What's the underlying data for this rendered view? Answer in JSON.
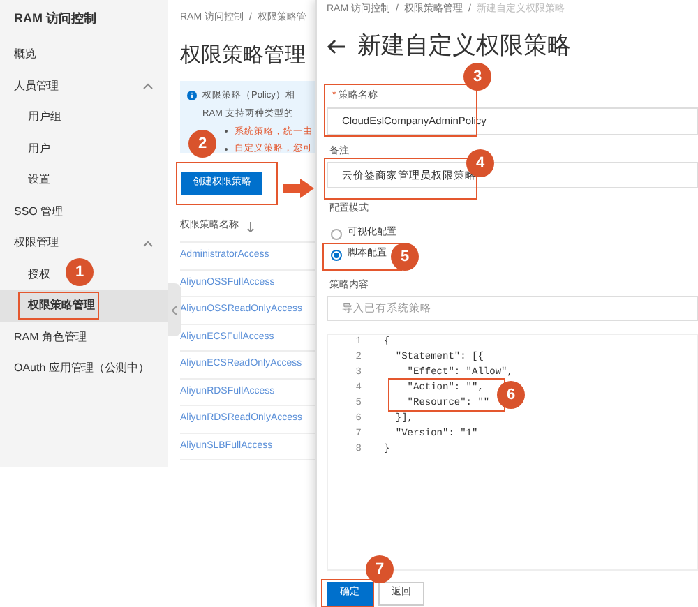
{
  "sidebar": {
    "title": "RAM 访问控制",
    "items": [
      {
        "label": "概览",
        "selected": false
      },
      {
        "label": "人员管理",
        "selected": false,
        "expanded": true,
        "children": [
          {
            "label": "用户组",
            "selected": false
          },
          {
            "label": "用户",
            "selected": false
          },
          {
            "label": "设置",
            "selected": false
          }
        ]
      },
      {
        "label": "SSO 管理",
        "selected": false
      },
      {
        "label": "权限管理",
        "selected": false,
        "expanded": true,
        "children": [
          {
            "label": "授权",
            "selected": false
          },
          {
            "label": "权限策略管理",
            "selected": true
          }
        ]
      },
      {
        "label": "RAM 角色管理",
        "selected": false
      },
      {
        "label": "OAuth 应用管理（公测中）",
        "selected": false
      }
    ]
  },
  "list_page": {
    "breadcrumb": {
      "separator": "/",
      "items": [
        "RAM 访问控制",
        "权限策略管"
      ]
    },
    "title": "权限策略管理",
    "info": {
      "lines": [
        "权限策略（Policy）相",
        "RAM 支持两种类型的"
      ],
      "bullets": [
        "系统策略，统一由",
        "自定义策略，您可"
      ]
    },
    "create_button": "创建权限策略",
    "column": "权限策略名称",
    "rows": [
      "AdministratorAccess",
      "AliyunOSSFullAccess",
      "AliyunOSSReadOnlyAccess",
      "AliyunECSFullAccess",
      "AliyunECSReadOnlyAccess",
      "AliyunRDSFullAccess",
      "AliyunRDSReadOnlyAccess",
      "AliyunSLBFullAccess"
    ]
  },
  "form_page": {
    "breadcrumb": {
      "separator": "/",
      "items": [
        "RAM 访问控制",
        "权限策略管理",
        "新建自定义权限策略"
      ]
    },
    "title": "新建自定义权限策略",
    "name_field": {
      "label": "策略名称",
      "required_mark": "*",
      "value": "CloudEslCompanyAdminPolicy"
    },
    "note_field": {
      "label": "备注",
      "value": "云价签商家管理员权限策略"
    },
    "mode": {
      "label": "配置模式",
      "options": [
        {
          "label": "可视化配置",
          "selected": false
        },
        {
          "label": "脚本配置",
          "selected": true
        }
      ]
    },
    "content": {
      "label": "策略内容",
      "placeholder": "导入已有系统策略",
      "code": [
        {
          "number": "1",
          "text": "{"
        },
        {
          "number": "2",
          "text": "  \"Statement\": [{"
        },
        {
          "number": "3",
          "text": "    \"Effect\": \"Allow\","
        },
        {
          "number": "4",
          "text": "    \"Action\": \"\","
        },
        {
          "number": "5",
          "text": "    \"Resource\": \"\""
        },
        {
          "number": "6",
          "text": "  }],"
        },
        {
          "number": "7",
          "text": "  \"Version\": \"1\""
        },
        {
          "number": "8",
          "text": "}"
        }
      ]
    },
    "buttons": [
      "确定",
      "返回"
    ]
  },
  "annotations": [
    "1",
    "2",
    "3",
    "4",
    "5",
    "6",
    "7"
  ]
}
